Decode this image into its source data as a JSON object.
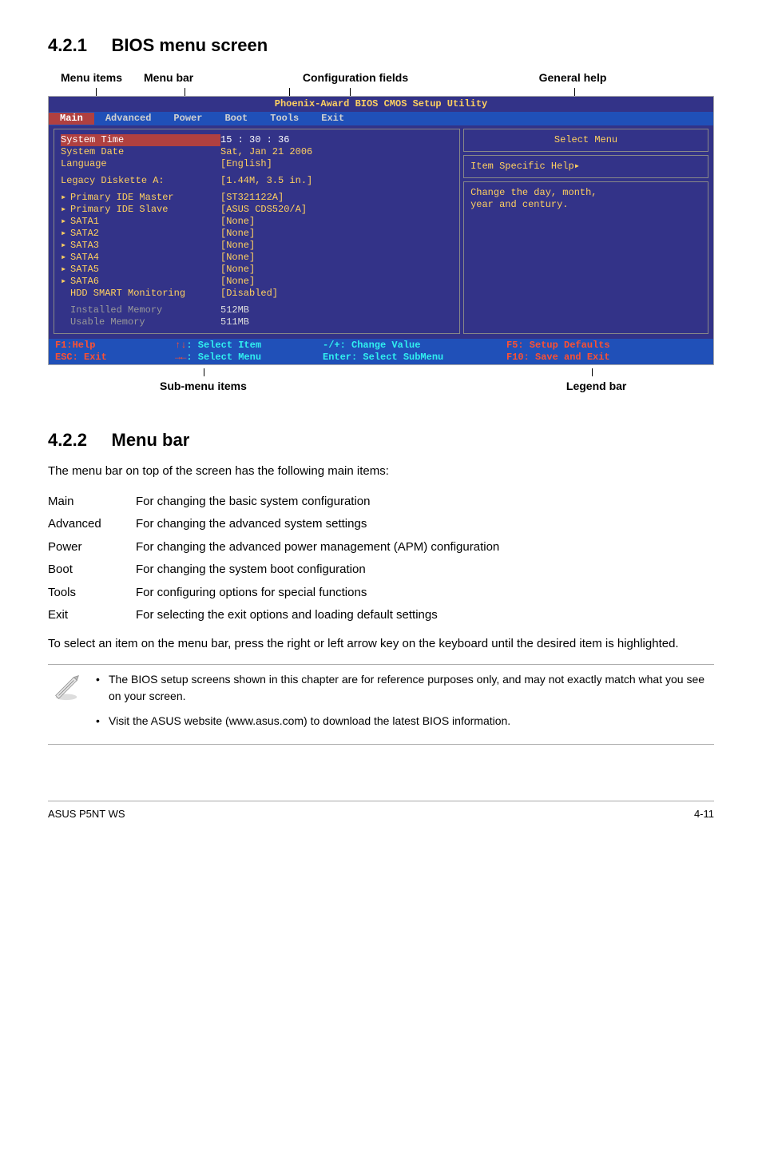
{
  "sections": {
    "s1_num": "4.2.1",
    "s1_title": "BIOS menu screen",
    "s2_num": "4.2.2",
    "s2_title": "Menu bar"
  },
  "annot": {
    "menu_items": "Menu items",
    "menu_bar": "Menu bar",
    "config_fields": "Configuration fields",
    "general_help": "General help",
    "submenu_items": "Sub-menu items",
    "legend_bar": "Legend bar"
  },
  "bios": {
    "title_left": "Phoenix-Award BIOS",
    "title_right": "CMOS Setup Utility",
    "menus": [
      "Main",
      "Advanced",
      "Power",
      "Boot",
      "Tools",
      "Exit"
    ],
    "active_menu": "Main",
    "rows": {
      "system_time_lbl": "System Time",
      "system_time_val": "15 : 30 : 36",
      "system_date_lbl": "System Date",
      "system_date_val": "Sat, Jan 21 2006",
      "language_lbl": "Language",
      "language_val": "[English]",
      "legacy_lbl": "Legacy Diskette A:",
      "legacy_val": "[1.44M, 3.5 in.]",
      "pim_lbl": "Primary IDE Master",
      "pim_val": "[ST321122A]",
      "pis_lbl": "Primary IDE Slave",
      "pis_val": "[ASUS CDS520/A]",
      "sata1_lbl": "SATA1",
      "sata1_val": "[None]",
      "sata2_lbl": "SATA2",
      "sata2_val": "[None]",
      "sata3_lbl": "SATA3",
      "sata3_val": "[None]",
      "sata4_lbl": "SATA4",
      "sata4_val": "[None]",
      "sata5_lbl": "SATA5",
      "sata5_val": "[None]",
      "sata6_lbl": "SATA6",
      "sata6_val": "[None]",
      "hdd_lbl": "HDD SMART Monitoring",
      "hdd_val": "[Disabled]",
      "inst_lbl": "Installed Memory",
      "inst_val": "512MB",
      "use_lbl": "Usable Memory",
      "use_val": "511MB"
    },
    "right": {
      "select_menu": "Select Menu",
      "item_specific": "Item Specific Help",
      "help_text1": "Change the day, month,",
      "help_text2": "year and century."
    },
    "footer": {
      "f1": "F1:Help",
      "esc": "ESC: Exit",
      "sel_item": ": Select Item",
      "sel_menu": ": Select Menu",
      "change": "-/+: Change Value",
      "enter": "Enter: Select SubMenu",
      "f5": "F5: Setup Defaults",
      "f10": "F10: Save and Exit"
    }
  },
  "body": {
    "mb_intro": "The menu bar on top of the screen has the following main items:",
    "defs": [
      {
        "k": "Main",
        "v": "For changing the basic system configuration"
      },
      {
        "k": "Advanced",
        "v": "For changing the advanced system settings"
      },
      {
        "k": "Power",
        "v": "For changing the advanced power management (APM) configuration"
      },
      {
        "k": "Boot",
        "v": "For changing the system boot configuration"
      },
      {
        "k": "Tools",
        "v": "For configuring options for special functions"
      },
      {
        "k": "Exit",
        "v": "For selecting the exit options and loading default settings"
      }
    ],
    "select_text": "To select an item on the menu bar, press the right or left arrow key on the keyboard until the desired item is highlighted.",
    "note1": "The BIOS setup screens shown in this chapter are for reference purposes only, and may not exactly match what you see on your screen.",
    "note2": "Visit the ASUS website (www.asus.com) to download the latest BIOS information."
  },
  "page_footer": {
    "left": "ASUS P5NT WS",
    "right": "4-11"
  }
}
